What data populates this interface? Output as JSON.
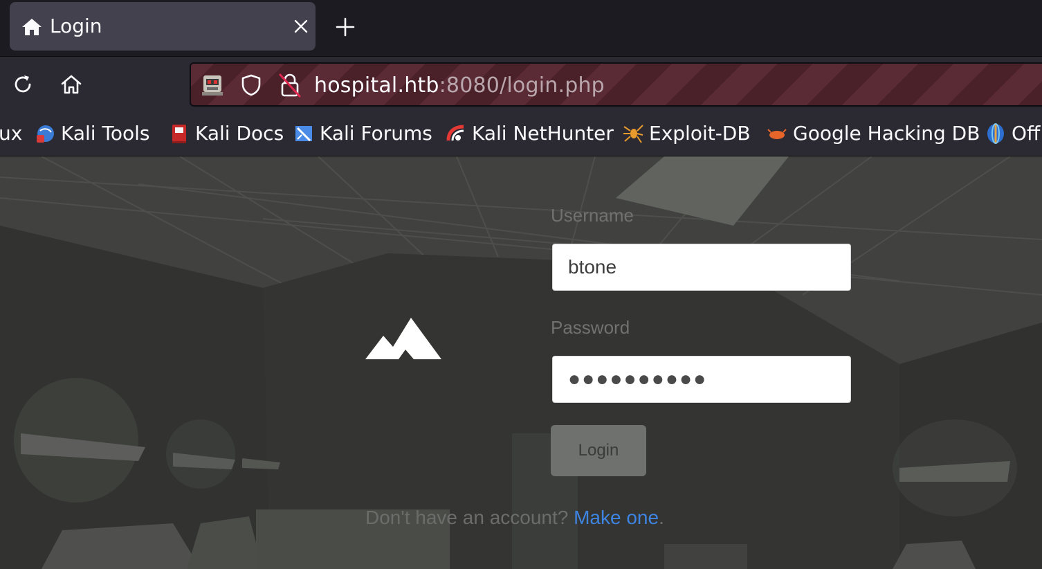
{
  "tab": {
    "title": "Login",
    "icon": "home-icon"
  },
  "navbar": {
    "url_host": "hospital.htb",
    "url_rest": ":8080/login.php"
  },
  "bookmarks": [
    {
      "label": "ux",
      "icon": "kali-linux-icon"
    },
    {
      "label": "Kali Tools",
      "icon": "kali-tools-icon"
    },
    {
      "label": "Kali Docs",
      "icon": "kali-docs-icon"
    },
    {
      "label": "Kali Forums",
      "icon": "kali-forums-icon"
    },
    {
      "label": "Kali NetHunter",
      "icon": "kali-nethunter-icon"
    },
    {
      "label": "Exploit-DB",
      "icon": "exploit-db-icon"
    },
    {
      "label": "Google Hacking DB",
      "icon": "google-hacking-db-icon"
    },
    {
      "label": "Off",
      "icon": "offsec-icon"
    }
  ],
  "login": {
    "username_label": "Username",
    "username_value": "btone",
    "password_label": "Password",
    "password_value": "●●●●●●●●●●",
    "button_label": "Login",
    "signup_text": "Don't have an account? ",
    "signup_link": "Make one",
    "signup_end": "."
  },
  "colors": {
    "accent_link": "#3e84e2",
    "urlbar_private": "#4a2029"
  }
}
